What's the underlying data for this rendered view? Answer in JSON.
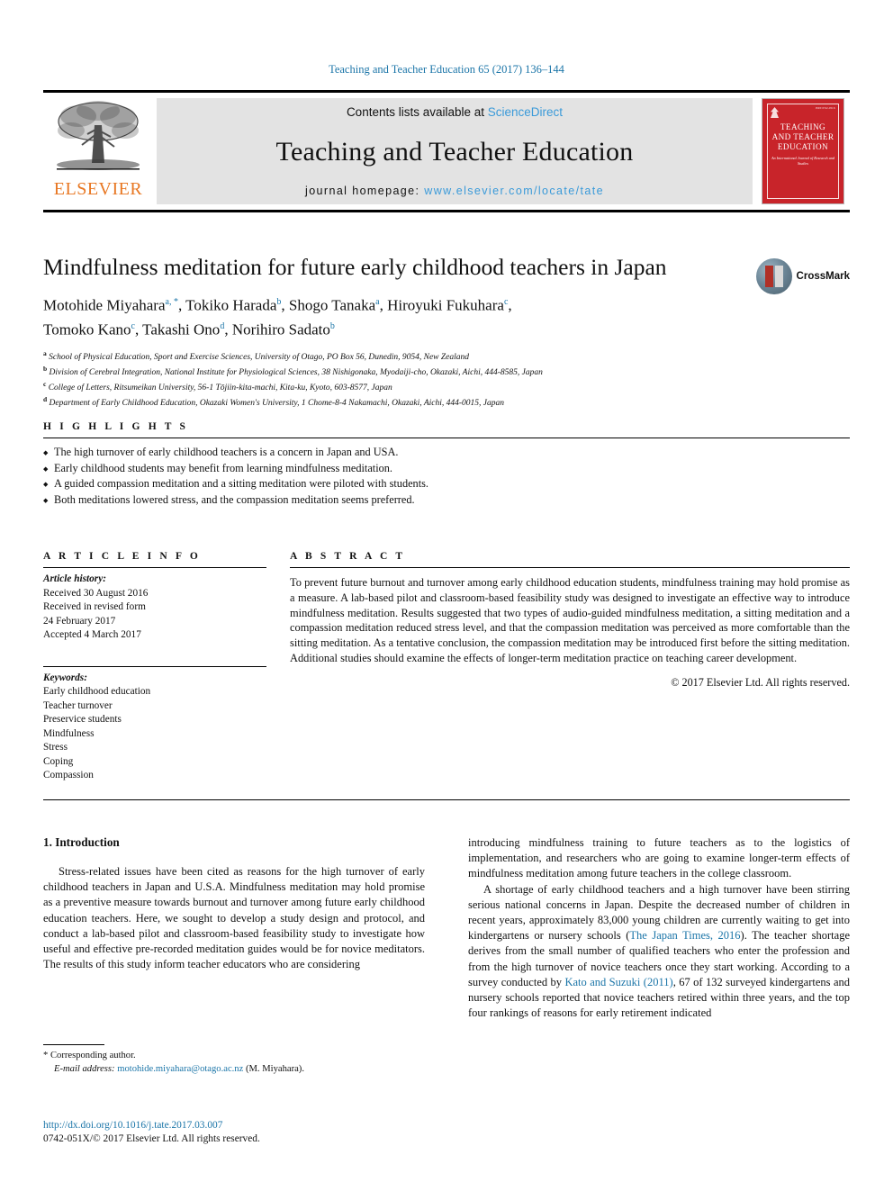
{
  "runhead": {
    "text": "Teaching and Teacher Education 65 (2017) 136–144"
  },
  "masthead": {
    "contents_prefix": "Contents lists available at ",
    "sciencedirect": "ScienceDirect",
    "journal_title": "Teaching and Teacher Education",
    "homepage_prefix": "journal homepage: ",
    "homepage_url": "www.elsevier.com/locate/tate",
    "publisher_wordmark": "ELSEVIER",
    "publisher_color": "#E87722",
    "cover": {
      "title_line1": "TEACHING",
      "title_line2": "AND TEACHER",
      "title_line3": "EDUCATION",
      "subtitle": "An International Journal of Research and Studies",
      "issn": "ISSN 0742-051X",
      "color": "#C8242A"
    }
  },
  "article": {
    "title": "Mindfulness meditation for future early childhood teachers in Japan",
    "crossmark_label": "CrossMark",
    "authors": [
      {
        "name": "Motohide Miyahara",
        "marks": "a, *"
      },
      {
        "name": "Tokiko Harada",
        "marks": "b"
      },
      {
        "name": "Shogo Tanaka",
        "marks": "a"
      },
      {
        "name": "Hiroyuki Fukuhara",
        "marks": "c"
      },
      {
        "name": "Tomoko Kano",
        "marks": "c"
      },
      {
        "name": "Takashi Ono",
        "marks": "d"
      },
      {
        "name": "Norihiro Sadato",
        "marks": "b"
      }
    ],
    "affiliations": [
      {
        "mark": "a",
        "text": "School of Physical Education, Sport and Exercise Sciences, University of Otago, PO Box 56, Dunedin, 9054, New Zealand"
      },
      {
        "mark": "b",
        "text": "Division of Cerebral Integration, National Institute for Physiological Sciences, 38 Nishigonaka, Myodaiji-cho, Okazaki, Aichi, 444-8585, Japan"
      },
      {
        "mark": "c",
        "text": "College of Letters, Ritsumeikan University, 56-1 Tōjiin-kita-machi, Kita-ku, Kyoto, 603-8577, Japan"
      },
      {
        "mark": "d",
        "text": "Department of Early Childhood Education, Okazaki Women's University, 1 Chome-8-4 Nakamachi, Okazaki, Aichi, 444-0015, Japan"
      }
    ]
  },
  "highlights": {
    "heading": "H I G H L I G H T S",
    "items": [
      "The high turnover of early childhood teachers is a concern in Japan and USA.",
      "Early childhood students may benefit from learning mindfulness meditation.",
      "A guided compassion meditation and a sitting meditation were piloted with students.",
      "Both meditations lowered stress, and the compassion meditation seems preferred."
    ]
  },
  "article_info": {
    "heading": "A R T I C L E  I N F O",
    "history_label": "Article history:",
    "history": [
      "Received 30 August 2016",
      "Received in revised form",
      "24 February 2017",
      "Accepted 4 March 2017"
    ],
    "keywords_label": "Keywords:",
    "keywords": [
      "Early childhood education",
      "Teacher turnover",
      "Preservice students",
      "Mindfulness",
      "Stress",
      "Coping",
      "Compassion"
    ]
  },
  "abstract": {
    "heading": "A B S T R A C T",
    "text": "To prevent future burnout and turnover among early childhood education students, mindfulness training may hold promise as a measure. A lab-based pilot and classroom-based feasibility study was designed to investigate an effective way to introduce mindfulness meditation. Results suggested that two types of audio-guided mindfulness meditation, a sitting meditation and a compassion meditation reduced stress level, and that the compassion meditation was perceived as more comfortable than the sitting meditation. As a tentative conclusion, the compassion meditation may be introduced first before the sitting meditation. Additional studies should examine the effects of longer-term meditation practice on teaching career development.",
    "copyright": "© 2017 Elsevier Ltd. All rights reserved."
  },
  "body": {
    "section_heading": "1. Introduction",
    "left_paragraph": "Stress-related issues have been cited as reasons for the high turnover of early childhood teachers in Japan and U.S.A. Mindfulness meditation may hold promise as a preventive measure towards burnout and turnover among future early childhood education teachers. Here, we sought to develop a study design and protocol, and conduct a lab-based pilot and classroom-based feasibility study to investigate how useful and effective pre-recorded meditation guides would be for novice meditators. The results of this study inform teacher educators who are considering",
    "right_paragraph_1_part1": "introducing mindfulness training to future teachers as to the logistics of implementation, and researchers who are going to examine longer-term effects of mindfulness meditation among future teachers in the college classroom.",
    "right_paragraph_2_part1": "A shortage of early childhood teachers and a high turnover have been stirring serious national concerns in Japan. Despite the decreased number of children in recent years, approximately 83,000 young children are currently waiting to get into kindergartens or nursery schools (",
    "right_citation_1": "The Japan Times, 2016",
    "right_paragraph_2_part2": "). The teacher shortage derives from the small number of qualified teachers who enter the profession and from the high turnover of novice teachers once they start working. According to a survey conducted by ",
    "right_citation_2": "Kato and Suzuki (2011)",
    "right_paragraph_2_part3": ", 67 of 132 surveyed kindergartens and nursery schools reported that novice teachers retired within three years, and the top four rankings of reasons for early retirement indicated"
  },
  "footer": {
    "corresponding_marker": "*",
    "corresponding_label": "Corresponding author.",
    "email_label": "E-mail address:",
    "email": "motohide.miyahara@otago.ac.nz",
    "email_suffix": "(M. Miyahara).",
    "doi": "http://dx.doi.org/10.1016/j.tate.2017.03.007",
    "issn_line": "0742-051X/© 2017 Elsevier Ltd. All rights reserved."
  }
}
